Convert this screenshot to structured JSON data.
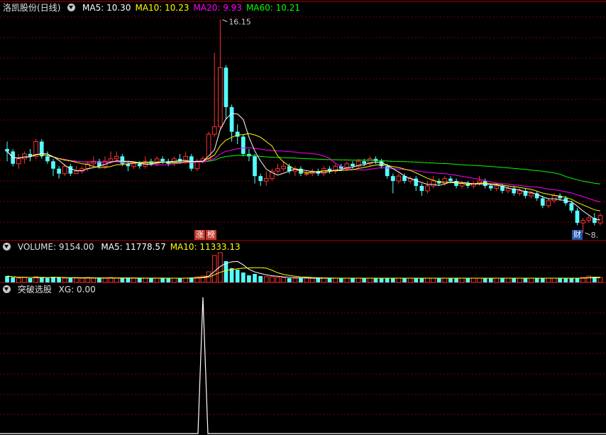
{
  "main": {
    "stock_name": "洛凯股份",
    "period": "(日线)",
    "ma_labels": [
      {
        "text": "MA5: 10.30",
        "color": "#ffffff"
      },
      {
        "text": "MA10: 10.23",
        "color": "#ffff00"
      },
      {
        "text": "MA20: 9.93",
        "color": "#ff00ff"
      },
      {
        "text": "MA60: 10.21",
        "color": "#00ff00"
      }
    ],
    "high_label": "16.15",
    "low_label": "8.",
    "badges": [
      {
        "text": "涨",
        "bg": "#c0392b"
      },
      {
        "text": "榜",
        "bg": "#c0392b"
      },
      {
        "text": "财",
        "bg": "#2255aa"
      }
    ]
  },
  "volume": {
    "label": "VOLUME: 9154.00",
    "ma_labels": [
      {
        "text": "MA5: 11778.57",
        "color": "#ffffff"
      },
      {
        "text": "MA10: 11333.13",
        "color": "#ffff00"
      }
    ]
  },
  "indicator": {
    "label": "突破选股",
    "value_label": "XG: 0.00"
  },
  "colors": {
    "up": "#ff3232",
    "down": "#54ffff",
    "grid": "#7a0000",
    "ma5": "#ffffff",
    "ma10": "#ffff00",
    "ma20": "#ff00ff",
    "ma60": "#00ff00"
  },
  "chart_data": {
    "type": "candlestick",
    "price_ylim": [
      7.5,
      16.6
    ],
    "candles": [
      [
        10.9,
        10.8,
        11.2,
        10.4
      ],
      [
        10.8,
        10.3,
        10.9,
        10.2
      ],
      [
        10.3,
        10.5,
        10.7,
        10.1
      ],
      [
        10.5,
        10.7,
        10.8,
        10.3
      ],
      [
        10.7,
        10.6,
        10.9,
        10.4
      ],
      [
        10.6,
        11.2,
        11.3,
        10.5
      ],
      [
        11.2,
        10.6,
        11.3,
        10.5
      ],
      [
        10.6,
        10.4,
        10.8,
        10.3
      ],
      [
        10.4,
        10.1,
        10.5,
        9.8
      ],
      [
        10.1,
        9.9,
        10.2,
        9.7
      ],
      [
        9.9,
        10.2,
        10.3,
        9.8
      ],
      [
        10.2,
        9.9,
        10.3,
        9.8
      ],
      [
        9.9,
        10.0,
        10.2,
        9.9
      ],
      [
        10.0,
        10.1,
        10.2,
        9.9
      ],
      [
        10.1,
        10.3,
        10.4,
        10.0
      ],
      [
        10.3,
        10.4,
        10.6,
        10.2
      ],
      [
        10.4,
        10.2,
        10.5,
        10.1
      ],
      [
        10.2,
        10.4,
        10.6,
        10.1
      ],
      [
        10.4,
        10.5,
        10.8,
        10.3
      ],
      [
        10.5,
        10.6,
        10.8,
        10.4
      ],
      [
        10.6,
        10.3,
        10.7,
        10.2
      ],
      [
        10.3,
        10.2,
        10.4,
        10.0
      ],
      [
        10.2,
        10.3,
        10.4,
        10.1
      ],
      [
        10.3,
        10.2,
        10.4,
        10.1
      ],
      [
        10.2,
        10.4,
        10.6,
        10.1
      ],
      [
        10.4,
        10.3,
        10.5,
        10.2
      ],
      [
        10.3,
        10.5,
        10.6,
        10.2
      ],
      [
        10.5,
        10.4,
        10.6,
        10.3
      ],
      [
        10.4,
        10.3,
        10.5,
        10.2
      ],
      [
        10.3,
        10.5,
        10.6,
        10.2
      ],
      [
        10.5,
        10.4,
        10.7,
        10.3
      ],
      [
        10.4,
        10.6,
        10.8,
        10.3
      ],
      [
        10.6,
        10.1,
        10.7,
        10.0
      ],
      [
        10.1,
        10.4,
        10.5,
        10.0
      ],
      [
        10.4,
        10.5,
        10.6,
        10.3
      ],
      [
        10.5,
        11.5,
        11.6,
        10.4
      ],
      [
        11.5,
        11.8,
        14.8,
        11.4
      ],
      [
        11.8,
        14.2,
        16.15,
        11.7
      ],
      [
        14.2,
        12.6,
        14.3,
        12.1
      ],
      [
        12.6,
        11.6,
        12.7,
        11.2
      ],
      [
        11.6,
        11.4,
        11.9,
        11.1
      ],
      [
        11.4,
        10.7,
        11.5,
        10.6
      ],
      [
        10.7,
        10.6,
        10.9,
        10.4
      ],
      [
        10.6,
        9.8,
        10.7,
        9.5
      ],
      [
        9.8,
        9.6,
        9.9,
        9.4
      ],
      [
        9.6,
        9.7,
        10.0,
        9.4
      ],
      [
        9.7,
        10.0,
        10.1,
        9.6
      ],
      [
        10.0,
        10.1,
        10.3,
        9.9
      ],
      [
        10.1,
        10.2,
        10.4,
        10.0
      ],
      [
        10.2,
        10.0,
        10.3,
        9.9
      ],
      [
        10.0,
        10.1,
        10.2,
        9.8
      ],
      [
        10.1,
        9.9,
        10.2,
        9.8
      ],
      [
        9.9,
        9.9,
        10.0,
        9.8
      ],
      [
        9.9,
        10.0,
        10.1,
        9.8
      ],
      [
        10.0,
        9.9,
        10.1,
        9.8
      ],
      [
        9.9,
        10.1,
        10.2,
        9.8
      ],
      [
        10.1,
        10.0,
        10.2,
        9.9
      ],
      [
        10.0,
        10.2,
        10.3,
        9.9
      ],
      [
        10.2,
        10.1,
        10.3,
        10.0
      ],
      [
        10.1,
        10.3,
        10.4,
        10.0
      ],
      [
        10.3,
        10.2,
        10.4,
        10.1
      ],
      [
        10.2,
        10.4,
        10.5,
        10.1
      ],
      [
        10.4,
        10.3,
        10.5,
        10.2
      ],
      [
        10.3,
        10.5,
        10.6,
        10.2
      ],
      [
        10.5,
        10.4,
        10.6,
        10.3
      ],
      [
        10.4,
        10.2,
        10.5,
        10.1
      ],
      [
        10.2,
        9.8,
        10.3,
        9.7
      ],
      [
        9.8,
        9.6,
        9.9,
        9.1
      ],
      [
        9.6,
        9.8,
        9.9,
        9.5
      ],
      [
        9.8,
        9.6,
        9.9,
        9.5
      ],
      [
        9.6,
        9.7,
        9.8,
        9.5
      ],
      [
        9.7,
        9.4,
        9.8,
        9.2
      ],
      [
        9.4,
        9.2,
        9.5,
        9.0
      ],
      [
        9.2,
        9.4,
        9.6,
        9.1
      ],
      [
        9.4,
        9.6,
        9.8,
        9.3
      ],
      [
        9.6,
        9.5,
        9.7,
        9.4
      ],
      [
        9.5,
        9.7,
        9.8,
        9.4
      ],
      [
        9.7,
        9.6,
        9.8,
        9.5
      ],
      [
        9.6,
        9.4,
        9.7,
        9.3
      ],
      [
        9.4,
        9.5,
        9.6,
        9.3
      ],
      [
        9.5,
        9.4,
        9.6,
        9.3
      ],
      [
        9.4,
        9.5,
        9.6,
        9.3
      ],
      [
        9.5,
        9.6,
        9.8,
        9.4
      ],
      [
        9.6,
        9.4,
        9.7,
        9.3
      ],
      [
        9.4,
        9.3,
        9.5,
        9.2
      ],
      [
        9.3,
        9.4,
        9.5,
        9.2
      ],
      [
        9.4,
        9.2,
        9.5,
        9.1
      ],
      [
        9.2,
        9.3,
        9.4,
        9.1
      ],
      [
        9.3,
        9.1,
        9.4,
        9.0
      ],
      [
        9.1,
        9.2,
        9.3,
        9.0
      ],
      [
        9.2,
        9.0,
        9.3,
        8.9
      ],
      [
        9.0,
        9.1,
        9.2,
        8.9
      ],
      [
        9.1,
        8.9,
        9.2,
        8.8
      ],
      [
        8.9,
        8.6,
        9.0,
        8.5
      ],
      [
        8.6,
        8.8,
        8.9,
        8.5
      ],
      [
        8.8,
        9.0,
        9.1,
        8.7
      ],
      [
        9.0,
        8.9,
        9.1,
        8.8
      ],
      [
        8.9,
        8.7,
        9.0,
        8.6
      ],
      [
        8.7,
        8.4,
        8.8,
        8.3
      ],
      [
        8.4,
        7.9,
        8.5,
        7.8
      ],
      [
        7.9,
        8.0,
        8.1,
        7.5
      ],
      [
        8.0,
        8.1,
        8.2,
        7.9
      ],
      [
        8.1,
        7.9,
        8.3,
        7.8
      ],
      [
        7.9,
        8.2,
        8.3,
        7.8
      ]
    ],
    "volumes": [
      9,
      7,
      6,
      7,
      6,
      8,
      7,
      6,
      8,
      7,
      6,
      6,
      6,
      6,
      7,
      6,
      6,
      6,
      7,
      6,
      6,
      6,
      6,
      6,
      6,
      6,
      6,
      6,
      6,
      6,
      6,
      6,
      7,
      8,
      9,
      15,
      38,
      42,
      30,
      20,
      18,
      14,
      10,
      12,
      9,
      8,
      8,
      7,
      7,
      6,
      6,
      6,
      6,
      6,
      6,
      6,
      6,
      6,
      6,
      6,
      6,
      6,
      6,
      6,
      6,
      6,
      6,
      6,
      6,
      6,
      6,
      6,
      6,
      6,
      6,
      6,
      6,
      6,
      6,
      6,
      6,
      6,
      6,
      6,
      6,
      6,
      6,
      6,
      6,
      6,
      6,
      6,
      6,
      6,
      6,
      6,
      6,
      6,
      6,
      6,
      7,
      9,
      8,
      7
    ],
    "xg_signal_index": 34
  }
}
